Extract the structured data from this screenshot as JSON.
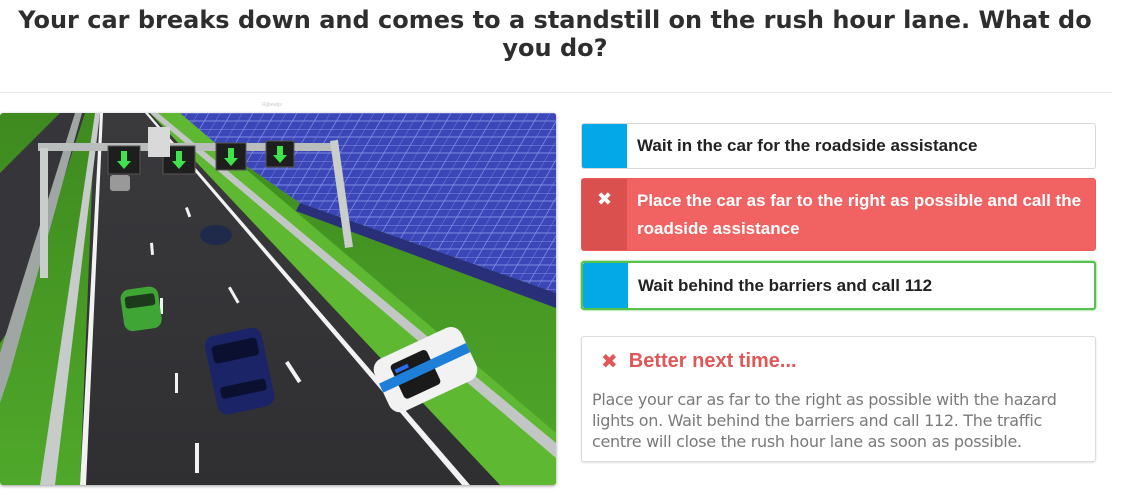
{
  "question": "Your car breaks down and comes to a standstill on the rush hour lane. What do you do?",
  "watermark": "Rijbewijs",
  "image": {
    "description_icon": "motorway-scene-image"
  },
  "answers": [
    {
      "label": "Wait in the car for the roadside assistance",
      "state": "neutral",
      "marker": ""
    },
    {
      "label": "Place the car as far to the right as possible and call the roadside assistance",
      "state": "wrong",
      "marker": "✖"
    },
    {
      "label": "Wait behind the barriers and call 112",
      "state": "correct",
      "marker": ""
    }
  ],
  "feedback": {
    "icon": "✖",
    "title": "Better next time...",
    "body": "Place your car as far to the right as possible with the hazard lights on. Wait behind the barriers and call 112. The traffic centre will close the rush hour lane as soon as possible."
  },
  "colors": {
    "marker_blue": "#03a9e6",
    "wrong_red": "#f16363",
    "correct_green": "#55c24b",
    "feedback_red": "#e05757"
  }
}
